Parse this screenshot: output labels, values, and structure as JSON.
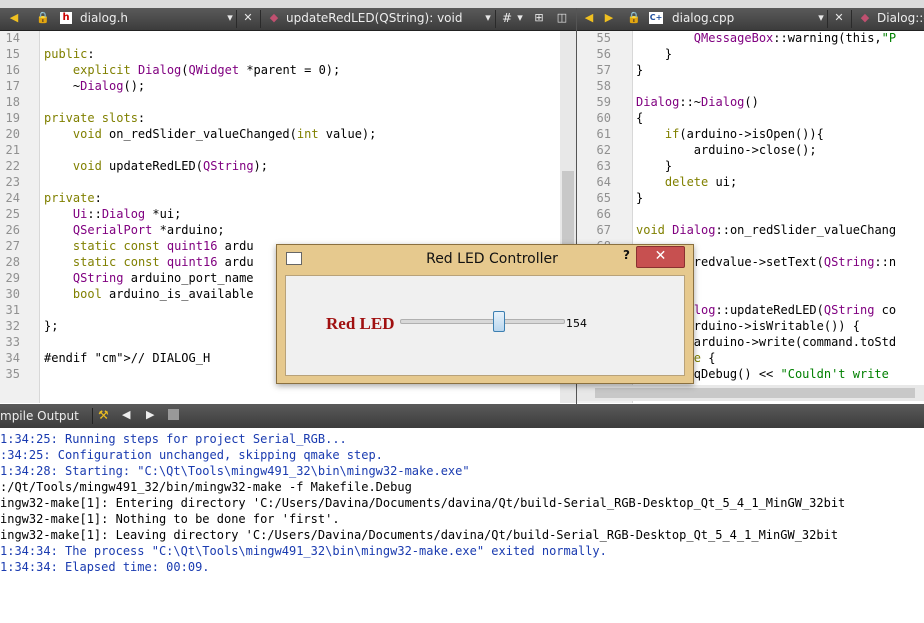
{
  "left_editor": {
    "file_label": "dialog.h",
    "function_label": "updateRedLED(QString): void",
    "hash_label": "#",
    "lines": [
      {
        "n": "14",
        "text": ""
      },
      {
        "n": "15",
        "text": "public:"
      },
      {
        "n": "16",
        "text": "    explicit Dialog(QWidget *parent = 0);"
      },
      {
        "n": "17",
        "text": "    ~Dialog();"
      },
      {
        "n": "18",
        "text": ""
      },
      {
        "n": "19",
        "text": "private slots:"
      },
      {
        "n": "20",
        "text": "    void on_redSlider_valueChanged(int value);"
      },
      {
        "n": "21",
        "text": ""
      },
      {
        "n": "22",
        "text": "    void updateRedLED(QString);"
      },
      {
        "n": "23",
        "text": ""
      },
      {
        "n": "24",
        "text": "private:"
      },
      {
        "n": "25",
        "text": "    Ui::Dialog *ui;"
      },
      {
        "n": "26",
        "text": "    QSerialPort *arduino;"
      },
      {
        "n": "27",
        "text": "    static const quint16 ardu"
      },
      {
        "n": "28",
        "text": "    static const quint16 ardu"
      },
      {
        "n": "29",
        "text": "    QString arduino_port_name"
      },
      {
        "n": "30",
        "text": "    bool arduino_is_available"
      },
      {
        "n": "31",
        "text": ""
      },
      {
        "n": "32",
        "text": "};"
      },
      {
        "n": "33",
        "text": ""
      },
      {
        "n": "34",
        "text": "#endif // DIALOG_H"
      },
      {
        "n": "35",
        "text": ""
      }
    ]
  },
  "right_editor": {
    "file_label": "dialog.cpp",
    "function_label": "Dialog::on",
    "lines": [
      {
        "n": "55",
        "text": "        QMessageBox::warning(this,\"P"
      },
      {
        "n": "56",
        "text": "    }"
      },
      {
        "n": "57",
        "text": "}"
      },
      {
        "n": "58",
        "text": ""
      },
      {
        "n": "59",
        "text": "Dialog::~Dialog()"
      },
      {
        "n": "60",
        "text": "{"
      },
      {
        "n": "61",
        "text": "    if(arduino->isOpen()){"
      },
      {
        "n": "62",
        "text": "        arduino->close();"
      },
      {
        "n": "63",
        "text": "    }"
      },
      {
        "n": "64",
        "text": "    delete ui;"
      },
      {
        "n": "65",
        "text": "}"
      },
      {
        "n": "66",
        "text": ""
      },
      {
        "n": "67",
        "text": "void Dialog::on_redSlider_valueChang"
      },
      {
        "n": "68",
        "text": ""
      },
      {
        "n": "69",
        "text": "    ui->redvalue->setText(QString::n"
      },
      {
        "n": "70",
        "text": ""
      },
      {
        "n": "71",
        "text": ""
      },
      {
        "n": "72",
        "text": "void Dialog::updateRedLED(QString co"
      },
      {
        "n": "73",
        "text": "    if(arduino->isWritable()) {"
      },
      {
        "n": "74",
        "text": "        arduino->write(command.toStd"
      },
      {
        "n": "75",
        "text": "    }else {"
      },
      {
        "n": "76",
        "text": "        qDebug() << \"Couldn't write"
      }
    ]
  },
  "compile_output": {
    "title": "mpile Output",
    "lines": [
      {
        "text": "1:34:25: Running steps for project Serial_RGB...",
        "color": "blue"
      },
      {
        "text": ":34:25: Configuration unchanged, skipping qmake step.",
        "color": "blue"
      },
      {
        "text": "1:34:28: Starting: \"C:\\Qt\\Tools\\mingw491_32\\bin\\mingw32-make.exe\"",
        "color": "blue"
      },
      {
        "text": ":/Qt/Tools/mingw491_32/bin/mingw32-make -f Makefile.Debug",
        "color": "black"
      },
      {
        "text": "ingw32-make[1]: Entering directory 'C:/Users/Davina/Documents/davina/Qt/build-Serial_RGB-Desktop_Qt_5_4_1_MinGW_32bit",
        "color": "black"
      },
      {
        "text": "ingw32-make[1]: Nothing to be done for 'first'.",
        "color": "black"
      },
      {
        "text": "ingw32-make[1]: Leaving directory 'C:/Users/Davina/Documents/davina/Qt/build-Serial_RGB-Desktop_Qt_5_4_1_MinGW_32bit",
        "color": "black"
      },
      {
        "text": "1:34:34: The process \"C:\\Qt\\Tools\\mingw491_32\\bin\\mingw32-make.exe\" exited normally.",
        "color": "blue"
      },
      {
        "text": "1:34:34: Elapsed time: 00:09.",
        "color": "blue"
      }
    ]
  },
  "dialog": {
    "title": "Red LED Controller",
    "help": "?",
    "close": "✕",
    "label": "Red LED",
    "value": "154",
    "slider_fraction": 0.6
  },
  "icons": [
    "lock-icon",
    "header-file-icon",
    "cpp-file-icon",
    "close-icon",
    "split-icon",
    "back-arrow-icon",
    "forward-arrow-icon",
    "build-icon"
  ]
}
